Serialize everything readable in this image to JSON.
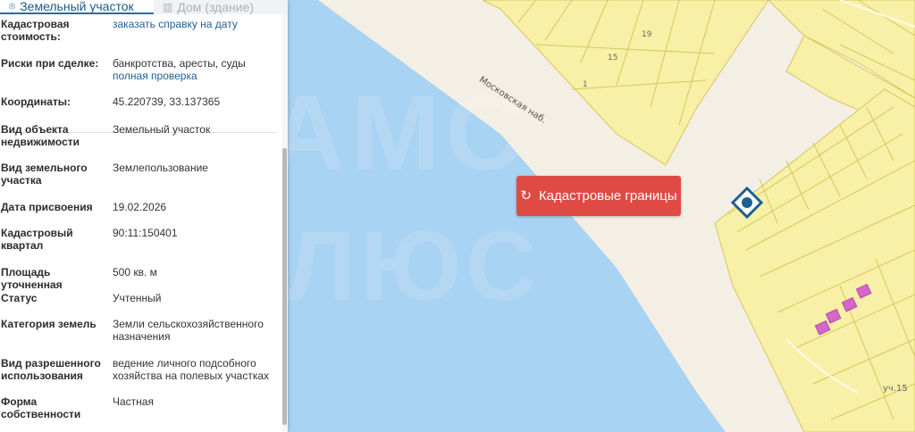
{
  "tabs": [
    {
      "label": "Земельный участок",
      "icon": "map-pin-icon",
      "active": true
    },
    {
      "label": "Дом (здание)",
      "icon": "building-icon",
      "active": false
    }
  ],
  "properties": [
    {
      "label": "Кадастровая стоимость:",
      "value": "заказать справку на дату",
      "value_is_link": true
    },
    {
      "label": "Риски при сделке:",
      "value": "банкротства, аресты, суды",
      "link": "полная проверка"
    },
    {
      "label": "Координаты:",
      "value": "45.220739, 33.137365"
    },
    {
      "label": "Вид объекта недвижимости",
      "value": "Земельный участок"
    },
    {
      "label": "Вид земельного участка",
      "value": "Землепользование"
    },
    {
      "label": "Дата присвоения",
      "value": "19.02.2026"
    },
    {
      "label": "Кадастровый квартал",
      "value": "90:11:150401"
    },
    {
      "label": "Площадь уточненная",
      "value": "500 кв. м"
    },
    {
      "label": "Статус",
      "value": "Учтенный"
    },
    {
      "label": "Категория земель",
      "value": "Земли сельскохозяйственного назначения"
    },
    {
      "label": "Вид разрешенного использования",
      "value": "ведение личного подсобного хозяйства на полевых участках"
    },
    {
      "label": "Форма собственности",
      "value": "Частная"
    }
  ],
  "map": {
    "cadastral_button": "Кадастровые границы",
    "street_label": "Московская наб.",
    "house_numbers": [
      "15",
      "19",
      "1",
      "уч.15"
    ],
    "watermark_lines": [
      "АМС",
      "ЛЮС"
    ],
    "colors": {
      "water": "#a9d3f2",
      "land": "#f4efe4",
      "parcels": "#f7f0a6",
      "parcel_border": "#d8c65e",
      "button": "#e04a44",
      "marker": "#1b5f95"
    }
  }
}
